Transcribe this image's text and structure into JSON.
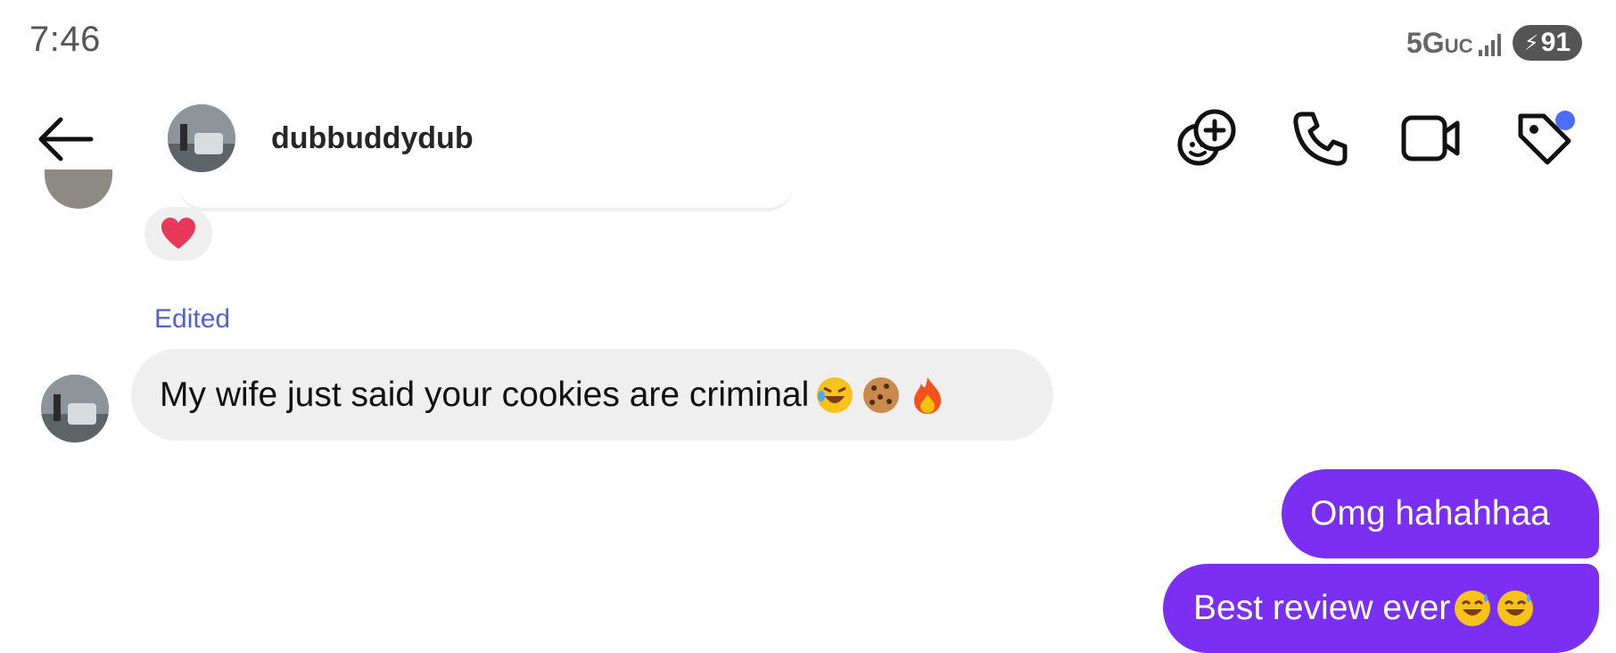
{
  "status_bar": {
    "time": "7:46",
    "network": "5G",
    "network_suffix": "UC",
    "battery": "91",
    "signal_icon": "signal-bars-icon",
    "charging_icon": "bolt-icon"
  },
  "header": {
    "back_icon": "arrow-left-icon",
    "username": "dubbuddydub",
    "actions": [
      {
        "icon": "add-effect-icon"
      },
      {
        "icon": "phone-icon"
      },
      {
        "icon": "video-camera-icon"
      },
      {
        "icon": "tag-icon",
        "badge_color": "#4f6cf7"
      }
    ]
  },
  "thread": {
    "reaction": {
      "emoji": "heart-icon",
      "color": "#e8385a"
    },
    "edited_label": "Edited",
    "incoming": {
      "text": "My wife just said your cookies are criminal ",
      "emojis": [
        "rolling-laughing-emoji",
        "cookie-emoji",
        "fire-emoji"
      ]
    },
    "outgoing": [
      {
        "text": "Omg hahahhaa",
        "emojis": []
      },
      {
        "text": "Best review ever",
        "emojis": [
          "sweat-smile-emoji",
          "sweat-smile-emoji"
        ]
      }
    ]
  },
  "colors": {
    "outgoing_bubble": "#7b2ff2",
    "incoming_bubble": "#efefef",
    "edited_label": "#4c63d2"
  }
}
